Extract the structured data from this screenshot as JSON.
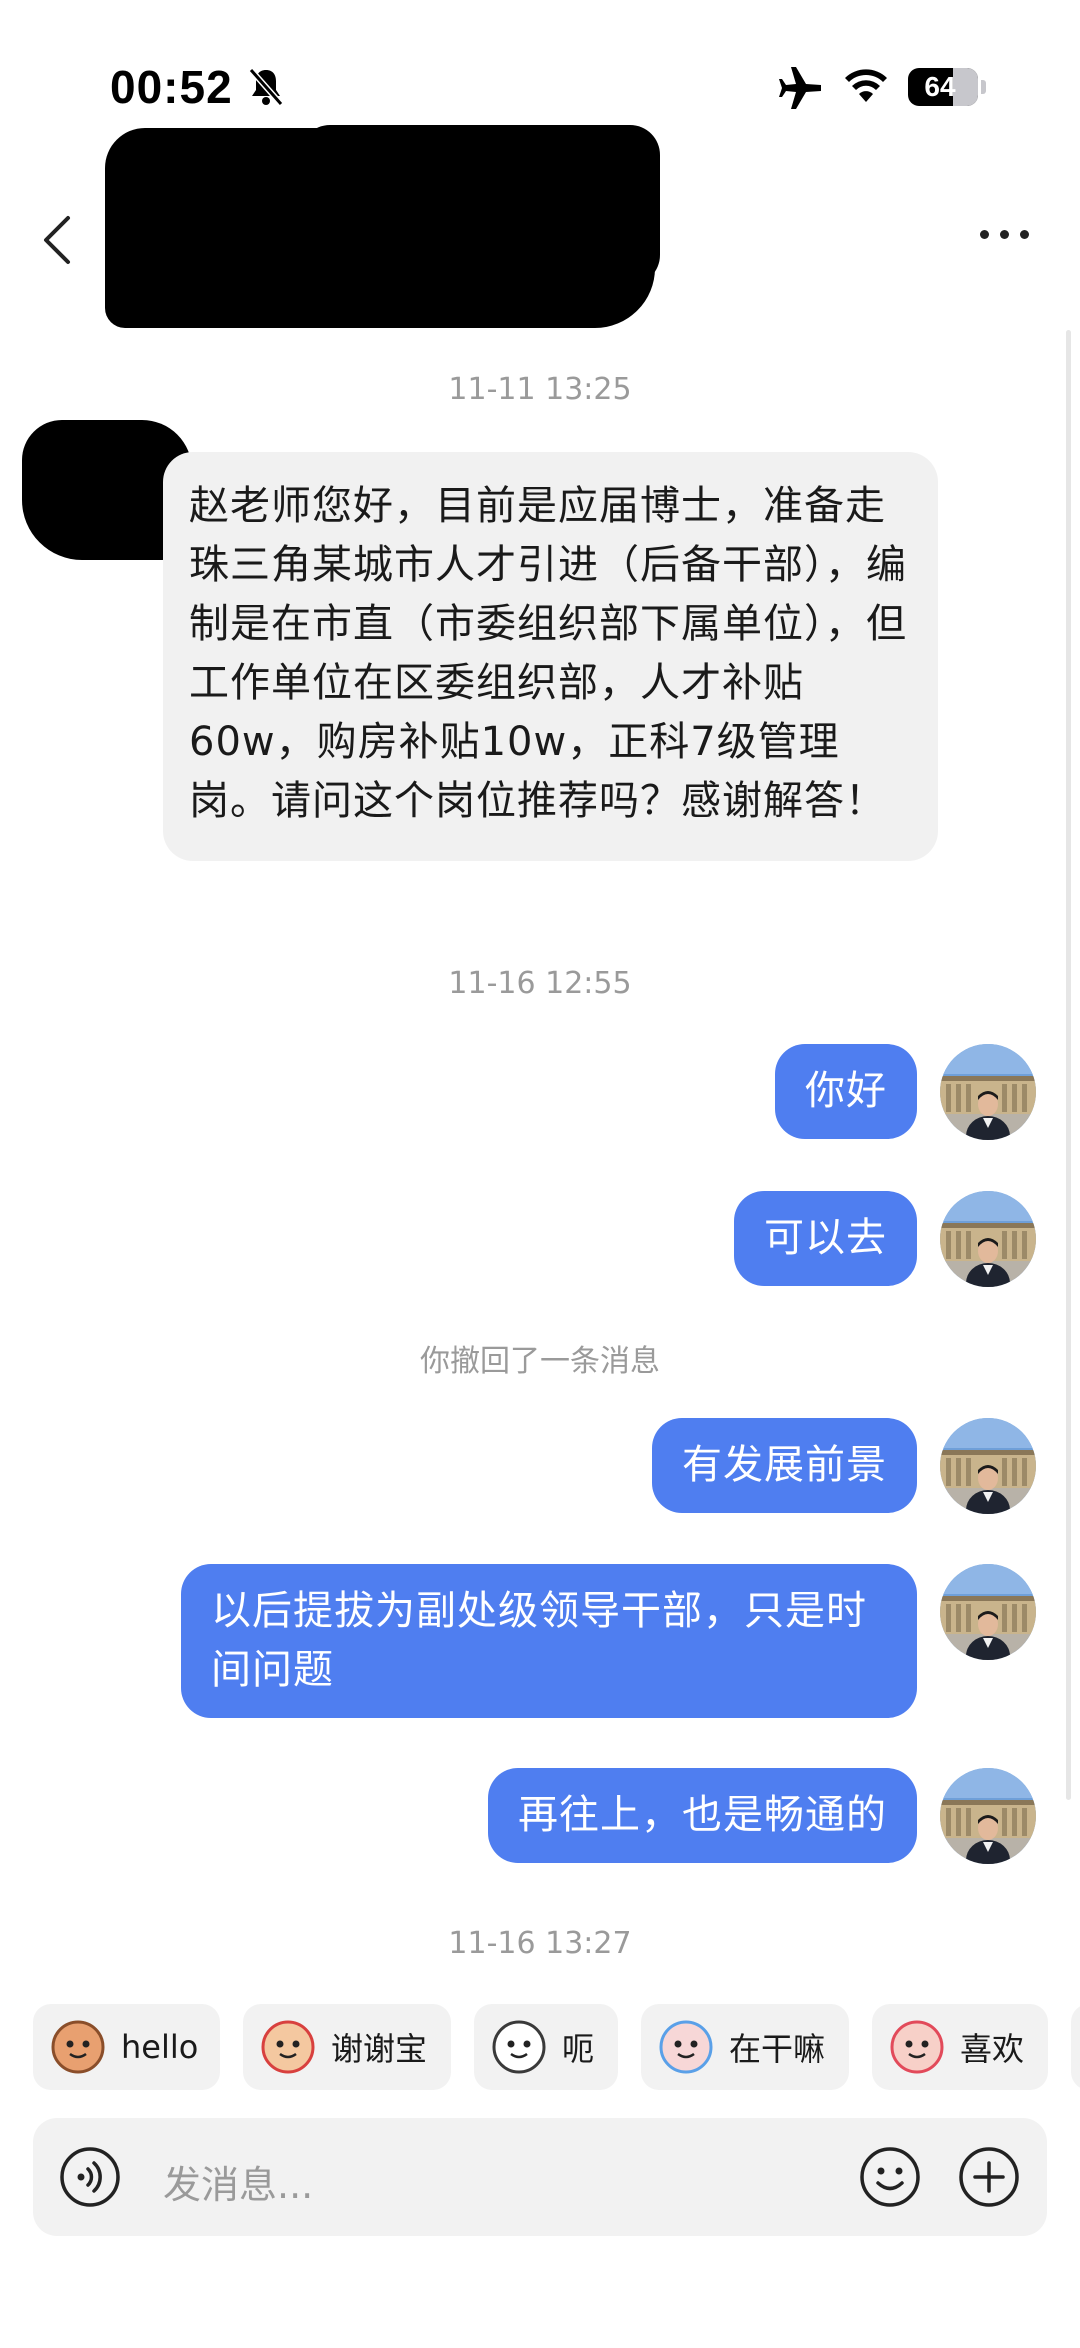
{
  "status_bar": {
    "time": "00:52",
    "battery": "64",
    "battery_level": 0.64,
    "icons": [
      "bell-slash-icon",
      "airplane-icon",
      "wifi-icon",
      "battery-icon"
    ]
  },
  "header": {
    "back_icon": "chevron-left-icon",
    "more_icon": "more-horizontal-icon"
  },
  "messages": {
    "ts1": "11-11 13:25",
    "incoming_1": "赵老师您好，目前是应届博士，准备走珠三角某城市人才引进（后备干部），编制是在市直（市委组织部下属单位），但工作单位在区委组织部，人才补贴60w，购房补贴10w，正科7级管理岗。请问这个岗位推荐吗？感谢解答！",
    "ts2": "11-16 12:55",
    "out_1": "你好",
    "out_2": "可以去",
    "recall_notice": "你撤回了一条消息",
    "out_3": "有发展前景",
    "out_4": "以后提拔为副处级领导干部，只是时间问题",
    "out_5": "再往上，也是畅通的",
    "ts3": "11-16 13:27"
  },
  "quick_replies": [
    {
      "label": "hello",
      "icon": "monkey-emoji-icon"
    },
    {
      "label": "谢谢宝",
      "icon": "rose-emoji-icon"
    },
    {
      "label": "呃",
      "icon": "cat-emoji-icon"
    },
    {
      "label": "在干嘛",
      "icon": "magnifier-emoji-icon"
    },
    {
      "label": "喜欢",
      "icon": "heart-emoji-icon"
    }
  ],
  "input": {
    "placeholder": "发消息...",
    "voice_icon": "voice-icon",
    "emoji_icon": "smiley-icon",
    "plus_icon": "plus-circle-icon"
  },
  "colors": {
    "outgoing_bubble": "#4f7ef0",
    "incoming_bubble": "#f1f1f1",
    "timestamp": "#9a9a9a"
  }
}
